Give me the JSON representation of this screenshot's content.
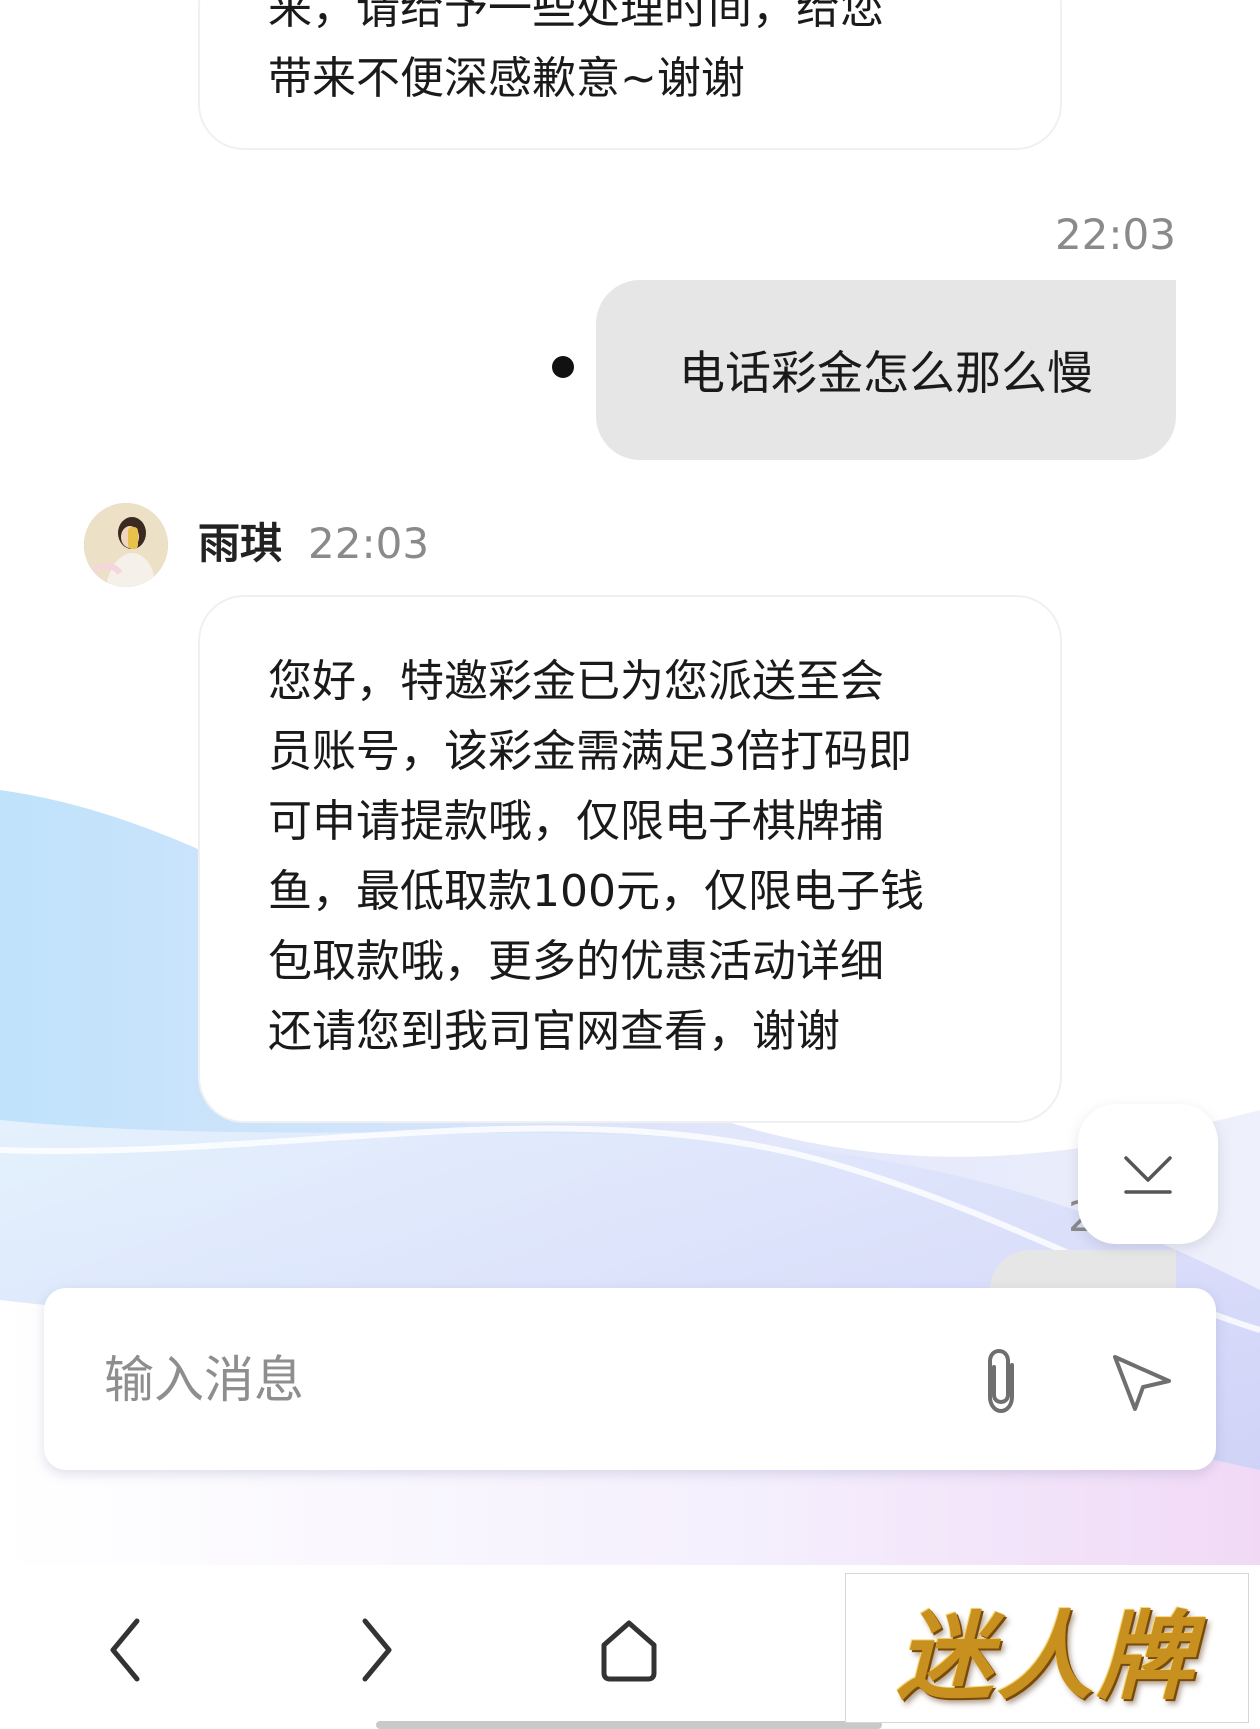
{
  "chat": {
    "top_message": {
      "text": "来，请给予一些处理时间，给您\n带来不便深感歉意~谢谢"
    },
    "outgoing": {
      "time": "22:03",
      "text": "电话彩金怎么那么慢"
    },
    "incoming": {
      "sender": "雨琪",
      "time": "22:03",
      "text": "您好，特邀彩金已为您派送至会\n员账号，该彩金需满足3倍打码即\n可申请提款哦，仅限电子棋牌捕\n鱼，最低取款100元，仅限电子钱\n包取款哦，更多的优惠活动详细\n还请您到我司官网查看，谢谢"
    },
    "partial_time": "2"
  },
  "composer": {
    "placeholder": "输入消息",
    "attach_icon": "paperclip-icon",
    "send_icon": "send-icon"
  },
  "scroll_down_icon": "scroll-to-bottom-icon",
  "nav": {
    "back_icon": "back-chevron-icon",
    "forward_icon": "forward-chevron-icon",
    "home_icon": "home-icon"
  },
  "watermark": {
    "text": "迷人牌"
  },
  "colors": {
    "outgoing_bubble": "#e6e6e6",
    "incoming_bubble": "#ffffff",
    "timestamp": "#8a8a8a",
    "logo_gold": "#c8901e"
  }
}
